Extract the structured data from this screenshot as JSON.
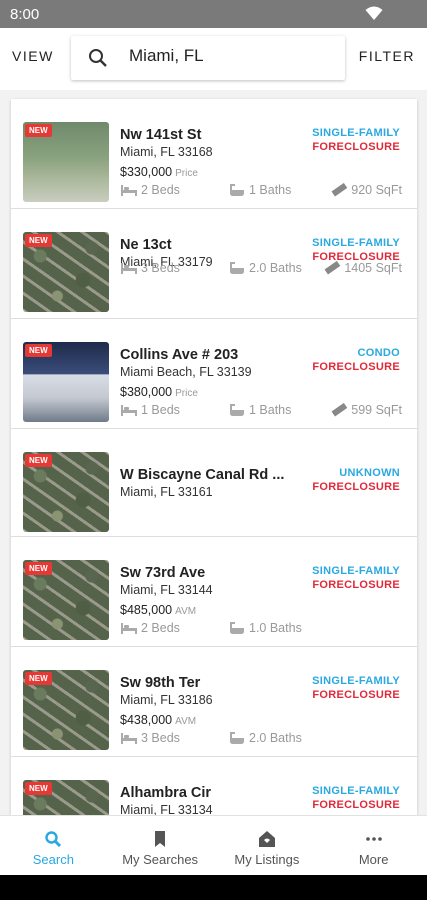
{
  "status_bar": {
    "time": "8:00"
  },
  "topbar": {
    "view_label": "VIEW",
    "filter_label": "FILTER",
    "search_value": "Miami, FL"
  },
  "listings": [
    {
      "badge": "NEW",
      "address": "Nw 141st St",
      "city": "Miami, FL 33168",
      "price": "$330,000",
      "price_label": "Price",
      "type": "SINGLE-FAMILY",
      "status": "FORECLOSURE",
      "beds": "2 Beds",
      "baths": "1 Baths",
      "sqft": "920 SqFt"
    },
    {
      "badge": "NEW",
      "address": "Ne 13ct",
      "city": "Miami, FL 33179",
      "price": "",
      "price_label": "",
      "type": "SINGLE-FAMILY",
      "status": "FORECLOSURE",
      "beds": "3 Beds",
      "baths": "2.0 Baths",
      "sqft": "1405 SqFt"
    },
    {
      "badge": "NEW",
      "address": "Collins Ave # 203",
      "city": "Miami Beach, FL 33139",
      "price": "$380,000",
      "price_label": "Price",
      "type": "CONDO",
      "status": "FORECLOSURE",
      "beds": "1 Beds",
      "baths": "1 Baths",
      "sqft": "599 SqFt"
    },
    {
      "badge": "NEW",
      "address": "W Biscayne Canal Rd ...",
      "city": "Miami, FL 33161",
      "price": "",
      "price_label": "",
      "type": "UNKNOWN",
      "status": "FORECLOSURE",
      "beds": "",
      "baths": "",
      "sqft": ""
    },
    {
      "badge": "NEW",
      "address": "Sw 73rd Ave",
      "city": "Miami, FL 33144",
      "price": "$485,000",
      "price_label": "AVM",
      "type": "SINGLE-FAMILY",
      "status": "FORECLOSURE",
      "beds": "2 Beds",
      "baths": "1.0 Baths",
      "sqft": ""
    },
    {
      "badge": "NEW",
      "address": "Sw 98th Ter",
      "city": "Miami, FL 33186",
      "price": "$438,000",
      "price_label": "AVM",
      "type": "SINGLE-FAMILY",
      "status": "FORECLOSURE",
      "beds": "3 Beds",
      "baths": "2.0 Baths",
      "sqft": ""
    },
    {
      "badge": "NEW",
      "address": "Alhambra Cir",
      "city": "Miami, FL 33134",
      "price": "",
      "price_label": "",
      "type": "SINGLE-FAMILY",
      "status": "FORECLOSURE",
      "beds": "",
      "baths": "",
      "sqft": ""
    }
  ],
  "bottom_nav": {
    "search": "Search",
    "my_searches": "My Searches",
    "my_listings": "My Listings",
    "more": "More"
  },
  "colors": {
    "accent": "#29a9e0",
    "foreclosure": "#e0293a",
    "badge": "#e53935"
  }
}
